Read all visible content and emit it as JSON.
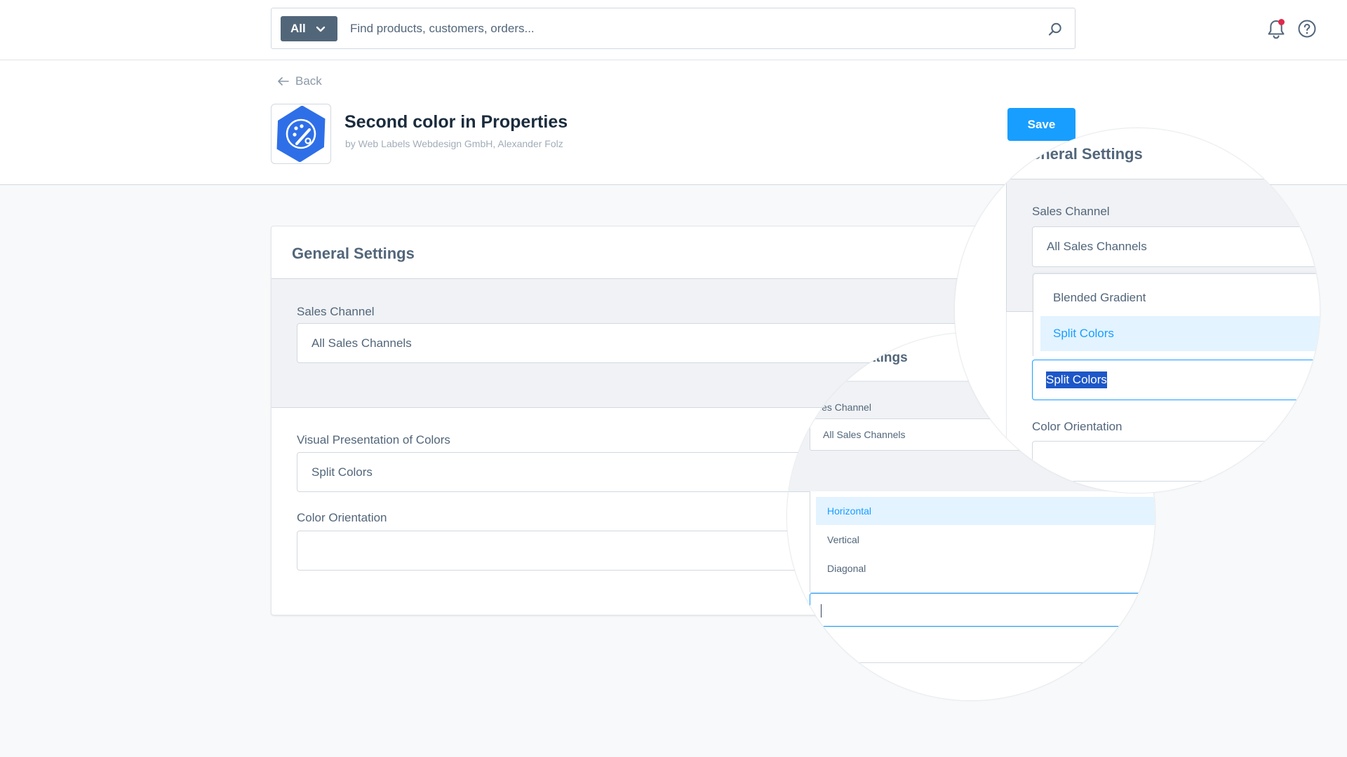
{
  "search": {
    "type_label": "All",
    "placeholder": "Find products, customers, orders..."
  },
  "header": {
    "back_label": "Back",
    "title": "Second color in Properties",
    "author": "by Web Labels Webdesign GmbH, Alexander Folz",
    "save_label": "Save"
  },
  "card": {
    "title": "General Settings",
    "sales_channel_label": "Sales Channel",
    "sales_channel_value": "All Sales Channels",
    "visual_label": "Visual Presentation of Colors",
    "visual_value": "Split Colors",
    "orientation_label": "Color Orientation",
    "orientation_value": ""
  },
  "zoom_small": {
    "title_fragment": "ttings",
    "sales_channel_fragment": "les Channel",
    "sales_channel_value": "All Sales Channels",
    "options": [
      "Horizontal",
      "Vertical",
      "Diagonal"
    ],
    "selected_option": "Horizontal"
  },
  "zoom_big": {
    "title_fragment": "eneral Settings",
    "sales_channel_label": "Sales Channel",
    "sales_channel_value": "All Sales Channels",
    "options": [
      "Blended Gradient",
      "Split Colors"
    ],
    "selected_option": "Split Colors",
    "input_value": "Split Colors",
    "orientation_label": "Color Orientation"
  },
  "colors": {
    "accent": "#189eff",
    "alert_dot": "#de294c",
    "selected_bg": "#e3f3ff",
    "selected_text": "#189eff",
    "text_selection": "#1d57c8"
  }
}
